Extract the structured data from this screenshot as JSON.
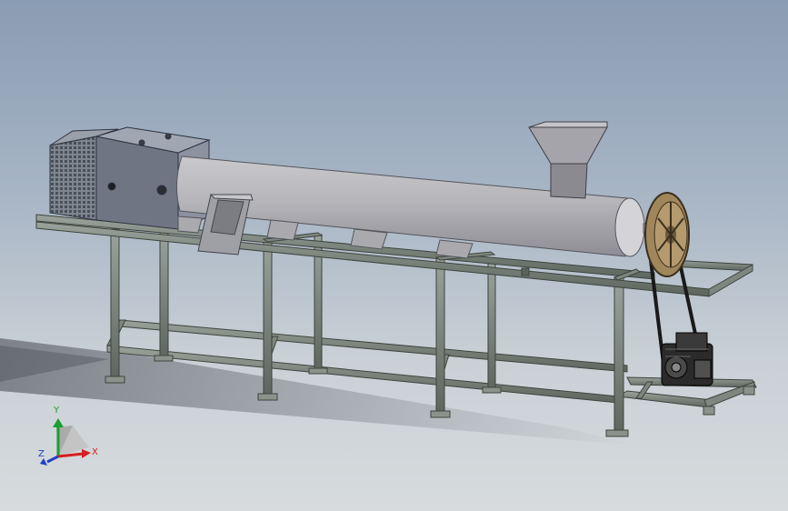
{
  "viewport": {
    "background_top": "#8a9cb3",
    "background_bottom": "#d7dbdd"
  },
  "model": {
    "frame_color": "#6f7a70",
    "barrel_color": "#b3b3b8",
    "motor_box_color": "#7d8390",
    "pulley_color": "#a0865b",
    "engine_color": "#2b2b2b"
  },
  "triad": {
    "x_label": "X",
    "y_label": "Y",
    "z_label": "Z",
    "x_color": "#d42020",
    "y_color": "#1aa030",
    "z_color": "#2040c0"
  }
}
